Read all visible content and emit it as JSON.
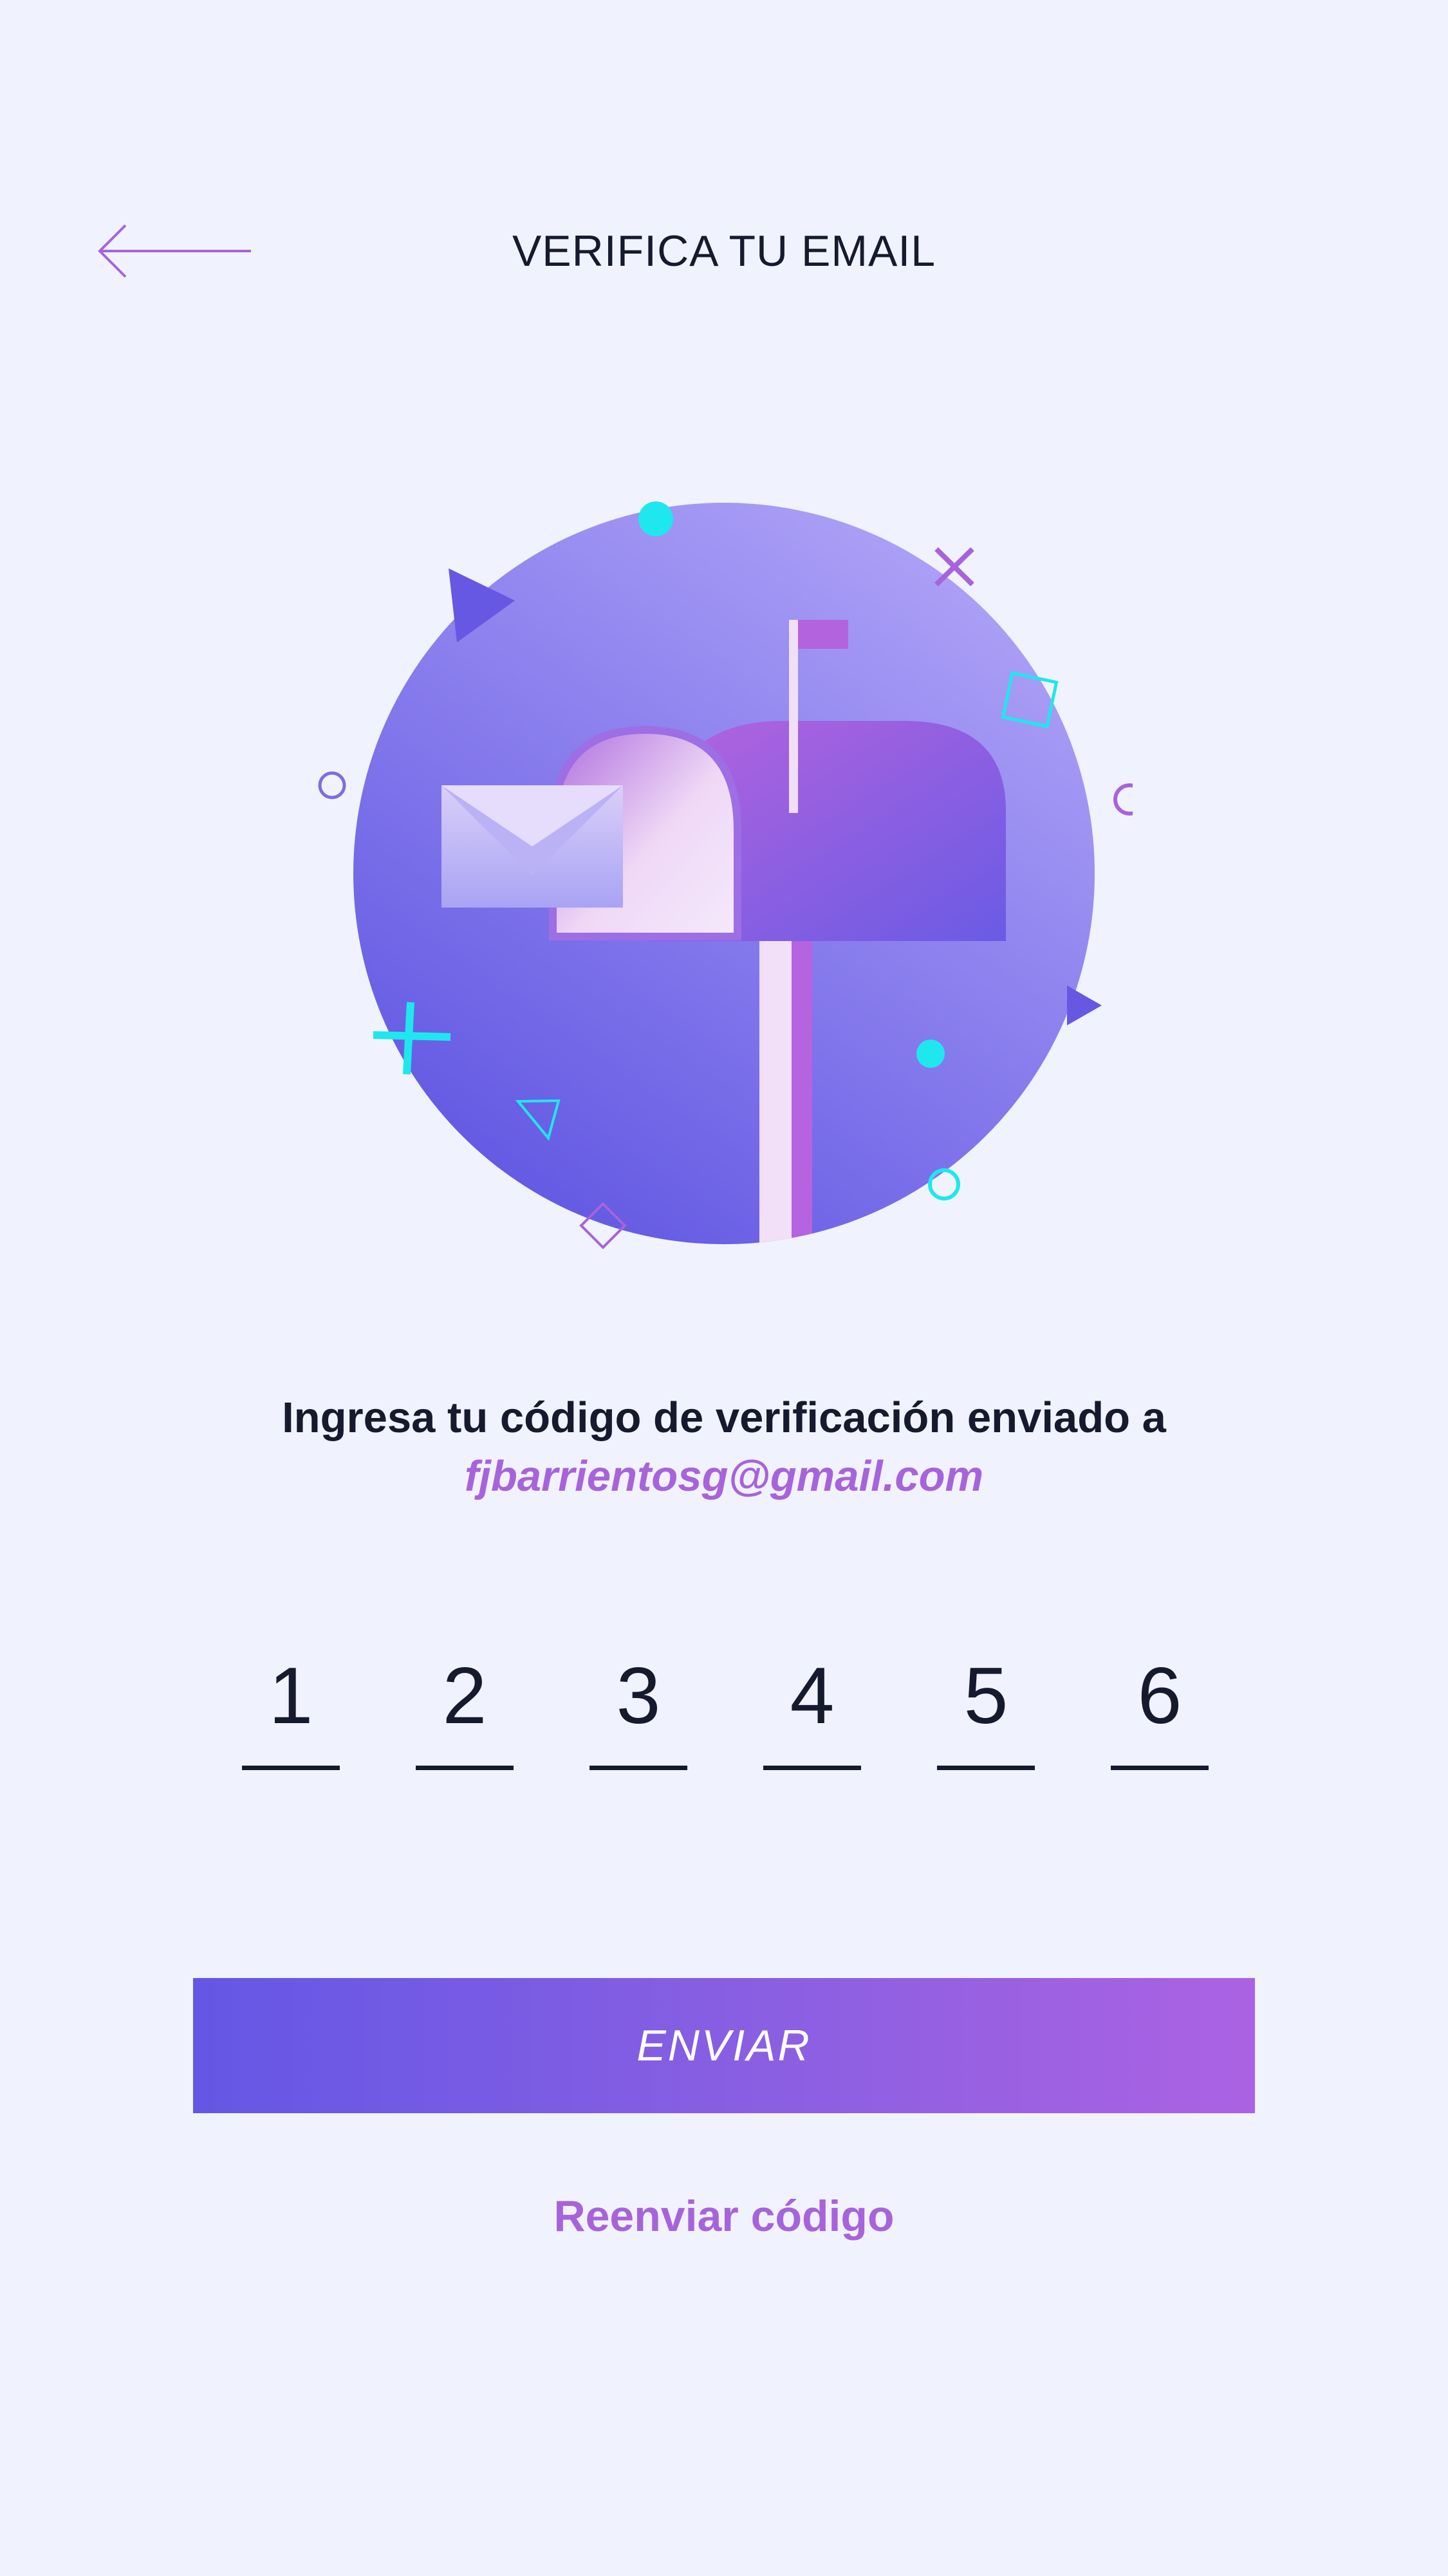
{
  "header": {
    "title": "VERIFICA TU EMAIL",
    "back_icon": "arrow-left-icon"
  },
  "illustration": {
    "icon": "mailbox-illustration"
  },
  "instructions": {
    "text": "Ingresa tu código de verificación enviado a",
    "email": "fjbarrientosg@gmail.com"
  },
  "code": {
    "digits": [
      "1",
      "2",
      "3",
      "4",
      "5",
      "6"
    ]
  },
  "actions": {
    "submit_label": "ENVIAR",
    "resend_label": "Reenviar código"
  },
  "colors": {
    "background": "#f0f3fe",
    "text": "#161a2e",
    "accent": "#a763dc",
    "gradient_start": "#6457e5",
    "gradient_end": "#ab62e3",
    "cyan": "#1fe7ee"
  }
}
